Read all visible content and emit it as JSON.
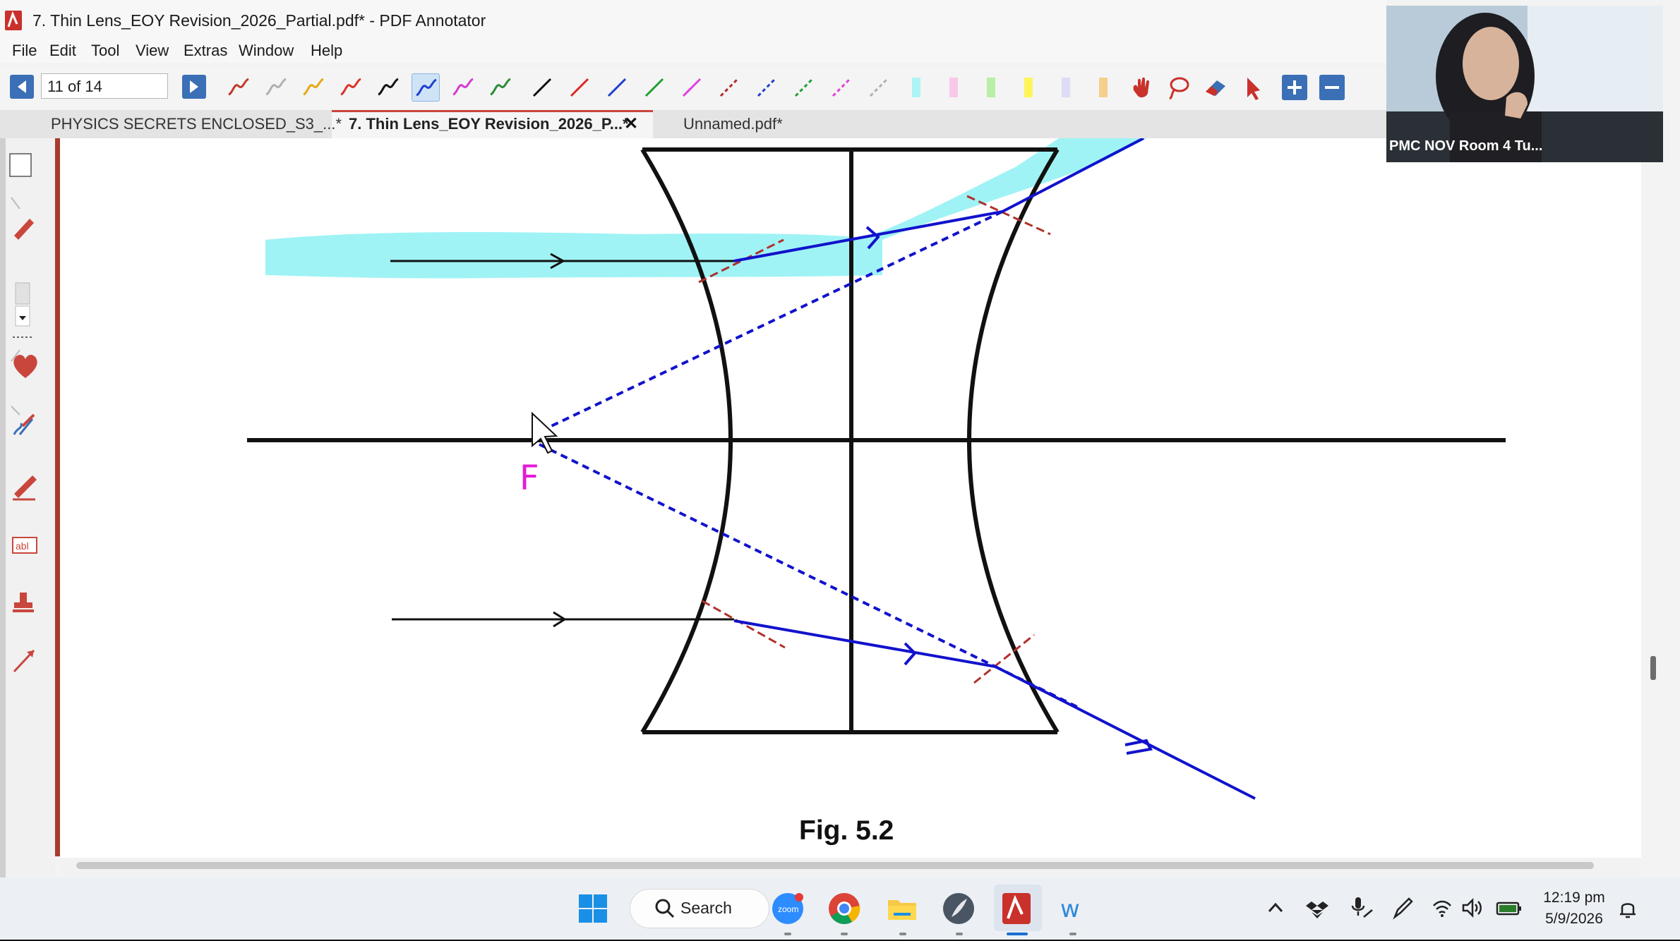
{
  "window": {
    "title": "7. Thin Lens_EOY Revision_2026_Partial.pdf* - PDF Annotator"
  },
  "menu": {
    "items": [
      "File",
      "Edit",
      "Tool",
      "View",
      "Extras",
      "Window",
      "Help"
    ]
  },
  "navigation": {
    "page_indicator": "11 of 14"
  },
  "tabs": [
    {
      "label": "PHYSICS SECRETS ENCLOSED_S3_...*",
      "active": false
    },
    {
      "label": "7. Thin Lens_EOY Revision_2026_P...*",
      "active": true
    },
    {
      "label": "Unnamed.pdf*",
      "active": false
    }
  ],
  "tab_close_glyph": "✕",
  "toolbar": {
    "pens": [
      {
        "icon": "pen-icon",
        "color": "#c0392b"
      },
      {
        "icon": "pen-icon",
        "color": "#b0b0b0"
      },
      {
        "icon": "pen-icon",
        "color": "#e6a817"
      },
      {
        "icon": "pen-icon",
        "color": "#d9342b"
      },
      {
        "icon": "pen-icon",
        "color": "#111111"
      },
      {
        "icon": "pen-icon",
        "color": "#1f3fd1",
        "selected": true
      },
      {
        "icon": "pen-icon",
        "color": "#d63ad1"
      },
      {
        "icon": "pen-icon",
        "color": "#2e8b3a"
      }
    ],
    "lines": [
      {
        "icon": "line-icon",
        "color": "#111111"
      },
      {
        "icon": "line-icon",
        "color": "#e02828"
      },
      {
        "icon": "line-icon",
        "color": "#1f3fd1"
      },
      {
        "icon": "line-icon",
        "color": "#21a033"
      },
      {
        "icon": "line-icon",
        "color": "#e33fe0"
      },
      {
        "icon": "dashed-line-icon",
        "color": "#b02a2a"
      },
      {
        "icon": "dashed-line-icon",
        "color": "#1f3fd1"
      },
      {
        "icon": "dashed-line-icon",
        "color": "#21a033"
      },
      {
        "icon": "dashed-line-icon",
        "color": "#e33fe0"
      },
      {
        "icon": "dashed-line-icon",
        "color": "#b0b0b0"
      }
    ],
    "highlighters": [
      "#aef4f6",
      "#f8c8e8",
      "#b8f0a8",
      "#fff55a",
      "#dcdcf4",
      "#f4d08a"
    ],
    "tools": [
      "hand-icon",
      "lasso-icon",
      "eraser-icon",
      "pointer-icon"
    ],
    "zoom": [
      "zoom-in-icon",
      "zoom-out-icon"
    ]
  },
  "document": {
    "caption": "Fig. 5.2",
    "focal_label": "F",
    "colors": {
      "ray": "#1212cc",
      "highlight": "#9ff3f5",
      "normal": "#b0302a",
      "label": "#e51ad6"
    }
  },
  "webcam": {
    "label": "PMC NOV Room 4 Tu..."
  },
  "taskbar": {
    "search_label": "Search",
    "time": "12:19 pm",
    "date": "5/9/2026",
    "apps": [
      "windows-start-icon",
      "zoom-icon",
      "chrome-icon",
      "file-explorer-icon",
      "pdf-annotator-icon",
      "app-w-icon"
    ],
    "tray": [
      "chevron-up-icon",
      "dropbox-icon",
      "mic-icon",
      "pen-icon",
      "wifi-icon",
      "speaker-icon",
      "battery-icon",
      "notification-icon"
    ]
  }
}
